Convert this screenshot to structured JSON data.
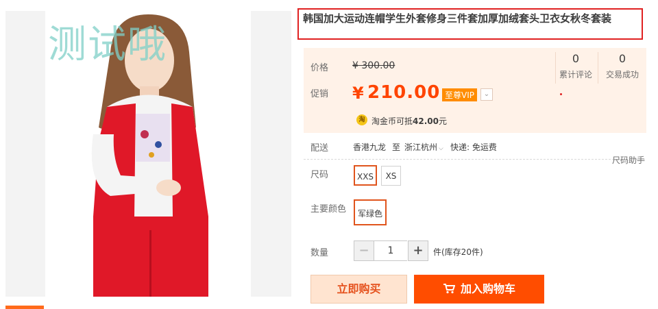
{
  "gallery": {
    "watermark": "测试哦"
  },
  "product": {
    "title": "韩国加大运动连帽学生外套修身三件套加厚加绒套头卫衣女秋冬套装"
  },
  "price": {
    "price_label": "价格",
    "original_price": "¥ 300.00",
    "promo_label": "促销",
    "currency": "¥",
    "promo_price": "210.00",
    "vip_badge": "至尊VIP",
    "vip_arrow": "⌄"
  },
  "stats": {
    "reviews_count": "0",
    "reviews_label": "累计评论",
    "sales_count": "0",
    "sales_label": "交易成功"
  },
  "coin": {
    "icon_text": "淘",
    "text_prefix": "淘金币可抵",
    "amount": "42.00",
    "text_suffix": "元"
  },
  "delivery": {
    "label": "配送",
    "from": "香港九龙",
    "to_word": "至",
    "to": "浙江杭州",
    "shipping": "快递: 免运费",
    "size_helper": "尺码助手"
  },
  "size": {
    "label": "尺码",
    "options": [
      "XXS",
      "XS"
    ],
    "selected": "XXS"
  },
  "color": {
    "label": "主要颜色",
    "options": [
      "军绿色"
    ]
  },
  "quantity": {
    "label": "数量",
    "minus": "−",
    "value": "1",
    "plus": "+",
    "stock": "件(库存20件)"
  },
  "actions": {
    "buy_now": "立即购买",
    "add_to_cart": "加入购物车"
  },
  "colors": {
    "accent": "#ff4400",
    "title_border": "#e02020",
    "panel_bg": "#fff2e8",
    "cart_bg": "#ff4d00"
  }
}
